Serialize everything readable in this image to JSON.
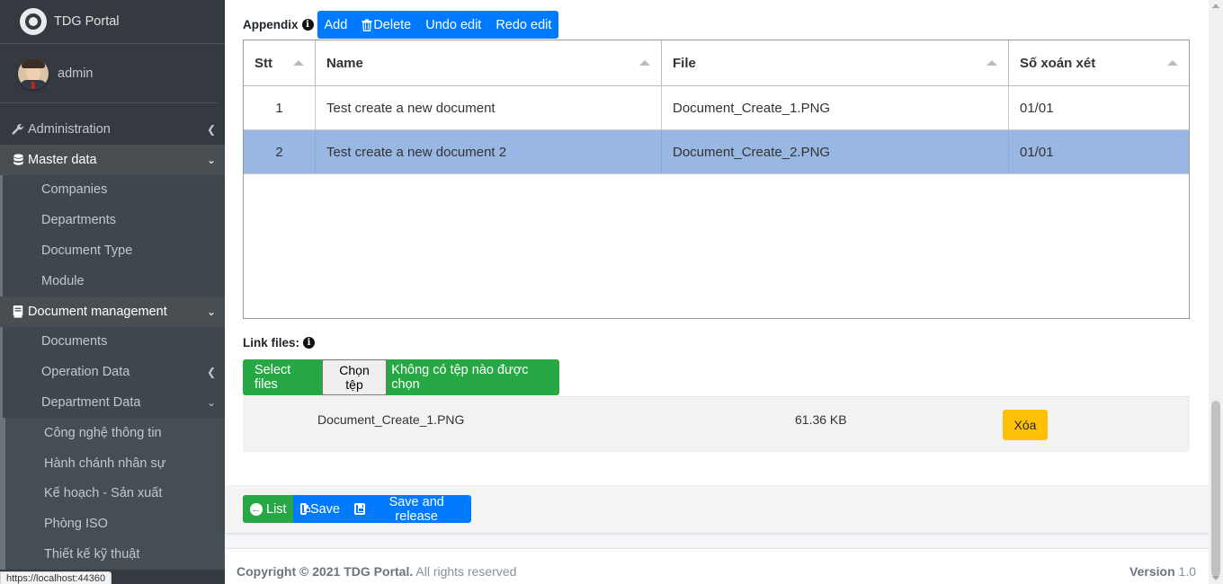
{
  "brand": {
    "title": "TDG Portal",
    "logo_icon": "tdg-logo-icon"
  },
  "user": {
    "name": "admin"
  },
  "sidebar": {
    "items": [
      {
        "label": "Administration",
        "icon": "wrench-icon",
        "state": "collapsed"
      },
      {
        "label": "Master data",
        "icon": "database-icon",
        "state": "open"
      },
      {
        "label": "Document management",
        "icon": "book-icon",
        "state": "open"
      }
    ],
    "master_data": [
      "Companies",
      "Departments",
      "Document Type",
      "Module"
    ],
    "document_management": {
      "documents": "Documents",
      "operation_data": "Operation Data",
      "department_data": "Department Data",
      "departments": [
        "Công nghệ thông tin",
        "Hành chánh nhân sự",
        "Kế hoạch - Sản xuất",
        "Phòng ISO",
        "Thiết kế kỹ thuật"
      ]
    }
  },
  "status_url": "https://localhost:44360",
  "appendix": {
    "label": "Appendix",
    "toolbar": {
      "add": "Add",
      "delete": "Delete",
      "undo": "Undo edit",
      "redo": "Redo edit"
    },
    "columns": [
      "Stt",
      "Name",
      "File",
      "Số xoán xét"
    ],
    "rows": [
      {
        "stt": "1",
        "name": "Test create a new document",
        "file": "Document_Create_1.PNG",
        "so": "01/01",
        "selected": false
      },
      {
        "stt": "2",
        "name": "Test create a new document 2",
        "file": "Document_Create_2.PNG",
        "so": "01/01",
        "selected": true
      }
    ]
  },
  "link_files": {
    "label": "Link files:",
    "select_label": "Select files",
    "choose_button": "Chọn tệp",
    "no_file_text": "Không có tệp nào được chọn",
    "files": [
      {
        "name": "Document_Create_1.PNG",
        "size": "61.36 KB",
        "delete_label": "Xóa"
      }
    ]
  },
  "actions": {
    "list": "List",
    "save": "Save",
    "save_release": "Save and release"
  },
  "footer": {
    "copyright_bold": "Copyright © 2021 TDG Portal.",
    "copyright_rest": " All rights reserved",
    "version_label": "Version",
    "version_value": " 1.0"
  },
  "colors": {
    "primary": "#007bff",
    "success": "#28a745",
    "warning": "#ffc107",
    "sidebar": "#343a40",
    "selected_row": "#99b7e3"
  }
}
